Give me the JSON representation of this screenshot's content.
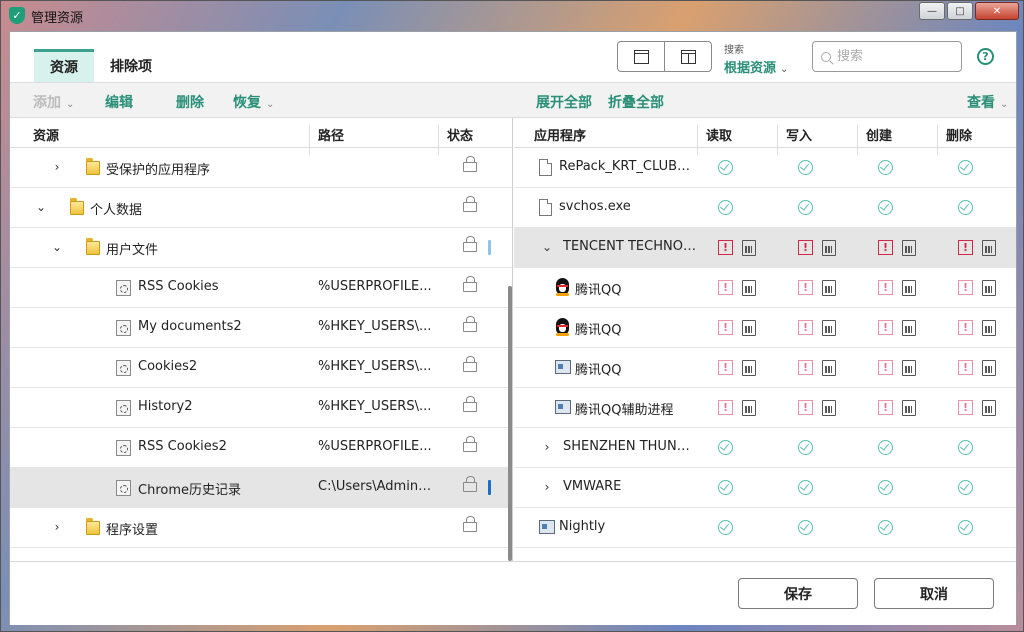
{
  "window": {
    "title": "管理资源",
    "min_glyph": "—",
    "max_glyph": "□",
    "close_glyph": "✕"
  },
  "tabs": [
    {
      "label": "资源",
      "active": true
    },
    {
      "label": "排除项",
      "active": false
    }
  ],
  "search": {
    "scope_caption": "搜索",
    "scope_value": "根据资源",
    "placeholder": "搜索"
  },
  "help_glyph": "?",
  "toolbar": {
    "add": "添加",
    "edit": "编辑",
    "delete": "删除",
    "restore": "恢复",
    "expand_all": "展开全部",
    "collapse_all": "折叠全部",
    "view": "查看"
  },
  "left_columns": [
    "资源",
    "路径",
    "状态"
  ],
  "left_rows": [
    {
      "name": "受保护的应用程序",
      "path": "",
      "type": "folder",
      "level": 1,
      "expander": "›",
      "marker": ""
    },
    {
      "name": "个人数据",
      "path": "",
      "type": "folder",
      "level": 0,
      "expander": "⌄",
      "marker": ""
    },
    {
      "name": "用户文件",
      "path": "",
      "type": "folder",
      "level": 1,
      "expander": "⌄",
      "marker": "light"
    },
    {
      "name": "RSS Cookies",
      "path": "%USERPROFILE...",
      "type": "item",
      "level": 2,
      "expander": "",
      "marker": ""
    },
    {
      "name": "My documents2",
      "path": "%HKEY_USERS\\...",
      "type": "item",
      "level": 2,
      "expander": "",
      "marker": ""
    },
    {
      "name": "Cookies2",
      "path": "%HKEY_USERS\\...",
      "type": "item",
      "level": 2,
      "expander": "",
      "marker": ""
    },
    {
      "name": "History2",
      "path": "%HKEY_USERS\\...",
      "type": "item",
      "level": 2,
      "expander": "",
      "marker": ""
    },
    {
      "name": "RSS Cookies2",
      "path": "%USERPROFILE...",
      "type": "item",
      "level": 2,
      "expander": "",
      "marker": ""
    },
    {
      "name": "Chrome历史记录",
      "path": "C:\\Users\\Admini...",
      "type": "item",
      "level": 2,
      "expander": "",
      "marker": "dark",
      "selected": true
    },
    {
      "name": "程序设置",
      "path": "",
      "type": "folder",
      "level": 1,
      "expander": "›",
      "marker": ""
    }
  ],
  "right_columns": [
    "应用程序",
    "读取",
    "写入",
    "创建",
    "删除"
  ],
  "right_rows": [
    {
      "name": "RePack_KRT_CLUB_3....",
      "icon": "doc",
      "level": 0,
      "expander": "",
      "perm": "ok"
    },
    {
      "name": "svchos.exe",
      "icon": "doc",
      "level": 0,
      "expander": "",
      "perm": "ok"
    },
    {
      "name": "TENCENT TECHNOL...",
      "icon": "",
      "level": 0,
      "expander": "⌄",
      "perm": "warn",
      "selected": true
    },
    {
      "name": "腾讯QQ",
      "icon": "qq",
      "level": 1,
      "expander": "",
      "perm": "warn-light"
    },
    {
      "name": "腾讯QQ",
      "icon": "qq",
      "level": 1,
      "expander": "",
      "perm": "warn-light"
    },
    {
      "name": "腾讯QQ",
      "icon": "app",
      "level": 1,
      "expander": "",
      "perm": "warn-light"
    },
    {
      "name": "腾讯QQ辅助进程",
      "icon": "app",
      "level": 1,
      "expander": "",
      "perm": "warn-light"
    },
    {
      "name": "SHENZHEN THUND...",
      "icon": "",
      "level": 0,
      "expander": "›",
      "perm": "ok"
    },
    {
      "name": "VMWARE",
      "icon": "",
      "level": 0,
      "expander": "›",
      "perm": "ok"
    },
    {
      "name": "Nightly",
      "icon": "app",
      "level": 0,
      "expander": "",
      "perm": "ok"
    }
  ],
  "footer": {
    "save": "保存",
    "cancel": "取消"
  },
  "colors": {
    "accent": "#2a8f78",
    "active_tab_bg": "#d7f1ec",
    "ok": "#5fbfae",
    "warn": "#cf2a4a",
    "warn_light": "#eb93a7"
  }
}
